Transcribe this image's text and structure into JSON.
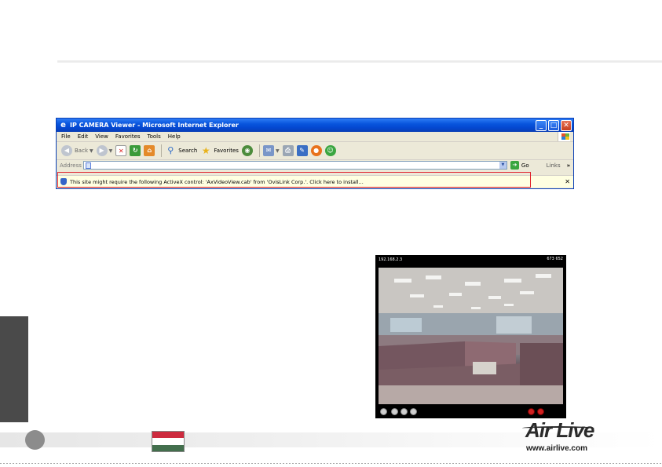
{
  "browser": {
    "title": "IP CAMERA Viewer - Microsoft Internet Explorer",
    "window_buttons": {
      "minimize": "_",
      "maximize": "□",
      "close": "✕"
    },
    "menu": [
      "File",
      "Edit",
      "View",
      "Favorites",
      "Tools",
      "Help"
    ],
    "toolbar": {
      "back": "Back",
      "search": "Search",
      "favorites": "Favorites"
    },
    "address": {
      "label": "Address",
      "go": "Go",
      "links": "Links",
      "more": "»"
    },
    "infobar": {
      "text": "This site might require the following ActiveX control: 'AxVideoView.cab' from 'OvisLink Corp.'. Click here to install...",
      "close": "✕"
    }
  },
  "viewer": {
    "ip": "192.168.2.3",
    "status": "673 652"
  },
  "footer": {
    "brand": "Air Live",
    "url": "www.airlive.com"
  },
  "colors": {
    "flag": [
      "#cd2a3e",
      "#ffffff",
      "#436f4d"
    ],
    "highlight_box": "#e0202a",
    "side_tab": "#4a4a4a"
  }
}
